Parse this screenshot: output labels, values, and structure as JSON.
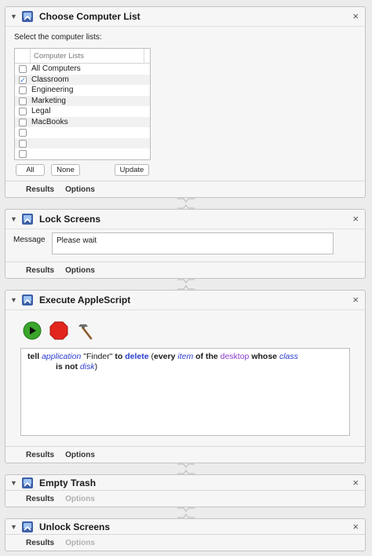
{
  "actions": {
    "choose_list": {
      "title": "Choose Computer List",
      "prompt": "Select the computer lists:",
      "column_header": "Computer Lists",
      "rows": [
        {
          "label": "All Computers",
          "checked": false
        },
        {
          "label": "Classroom",
          "checked": true
        },
        {
          "label": "Engineering",
          "checked": false
        },
        {
          "label": "Marketing",
          "checked": false
        },
        {
          "label": "Legal",
          "checked": false
        },
        {
          "label": "MacBooks",
          "checked": false
        },
        {
          "label": "",
          "checked": false
        },
        {
          "label": "",
          "checked": false
        },
        {
          "label": "",
          "checked": false
        }
      ],
      "buttons": {
        "all": "All",
        "none": "None",
        "update": "Update"
      },
      "footer": {
        "results": "Results",
        "options": "Options"
      }
    },
    "lock_screens": {
      "title": "Lock Screens",
      "message_label": "Message",
      "message_value": "Please wait",
      "footer": {
        "results": "Results",
        "options": "Options"
      }
    },
    "execute_applescript": {
      "title": "Execute AppleScript",
      "script": {
        "tell": "tell",
        "application": "application",
        "finder": "\"Finder\"",
        "to": "to",
        "delete": "delete",
        "open_paren": "(",
        "every": "every",
        "item": "item",
        "of_the": "of the",
        "desktop": "desktop",
        "whose": "whose",
        "class_word": "class",
        "is_not": "is not",
        "disk": "disk",
        "close_paren": ")"
      },
      "footer": {
        "results": "Results",
        "options": "Options"
      }
    },
    "empty_trash": {
      "title": "Empty Trash",
      "footer": {
        "results": "Results",
        "options": "Options"
      }
    },
    "unlock_screens": {
      "title": "Unlock Screens",
      "footer": {
        "results": "Results",
        "options": "Options"
      }
    }
  },
  "close_glyph": "×",
  "disclosure_glyph": "▼",
  "checkmark_glyph": "✓",
  "icons": [
    "automator-action-icon",
    "run-icon",
    "stop-icon",
    "compile-hammer-icon",
    "connector-icon"
  ],
  "colors": {
    "keyword_blue": "#2b3ccf",
    "property_purple": "#8b3bd0",
    "run_green": "#3aa52b",
    "stop_red": "#e3261d"
  }
}
